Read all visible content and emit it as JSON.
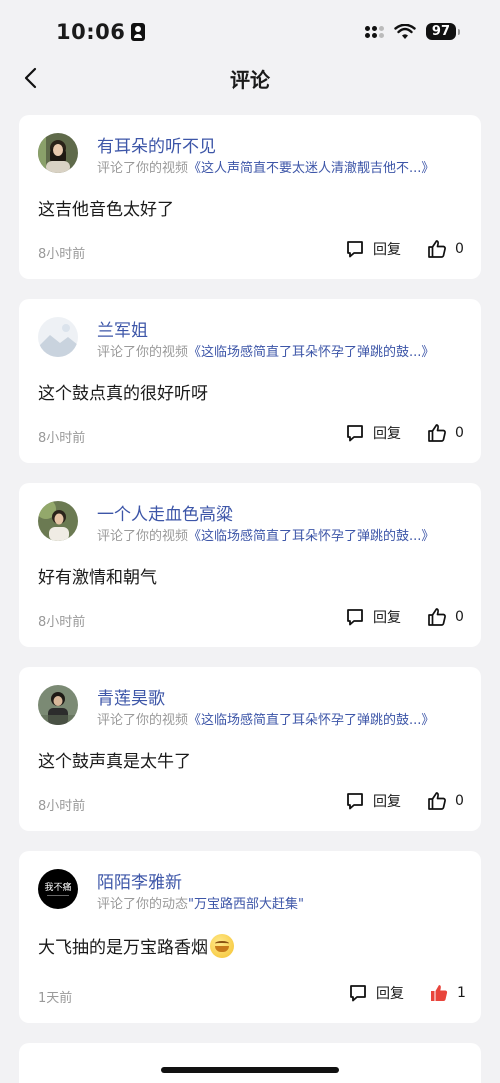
{
  "status": {
    "time": "10:06",
    "battery": "97"
  },
  "nav": {
    "title": "评论"
  },
  "comments": [
    {
      "user": "有耳朵的听不见",
      "prefix": "评论了你的视频",
      "target": "《这人声简直不要太迷人清澈靓吉他不...》",
      "text": "这吉他音色太好了",
      "time": "8小时前",
      "reply": "回复",
      "likes": "0",
      "liked": false
    },
    {
      "user": "兰军姐",
      "prefix": "评论了你的视频",
      "target": "《这临场感简直了耳朵怀孕了弹跳的鼓...》",
      "text": "这个鼓点真的很好听呀",
      "time": "8小时前",
      "reply": "回复",
      "likes": "0",
      "liked": false
    },
    {
      "user": "一个人走血色高粱",
      "prefix": "评论了你的视频",
      "target": "《这临场感简直了耳朵怀孕了弹跳的鼓...》",
      "text": "好有激情和朝气",
      "time": "8小时前",
      "reply": "回复",
      "likes": "0",
      "liked": false
    },
    {
      "user": "青莲昊歌",
      "prefix": "评论了你的视频",
      "target": "《这临场感简直了耳朵怀孕了弹跳的鼓...》",
      "text": "这个鼓声真是太牛了",
      "time": "8小时前",
      "reply": "回复",
      "likes": "0",
      "liked": false
    },
    {
      "user": "陌陌李雅新",
      "prefix": "评论了你的动态",
      "target": "\"万宝路西部大赶集\"",
      "text": "大飞抽的是万宝路香烟",
      "time": "1天前",
      "reply": "回复",
      "likes": "1",
      "liked": true,
      "avatar_text": "我不痛"
    }
  ],
  "colors": {
    "link": "#3d56a8",
    "like_active": "#e8453c"
  }
}
